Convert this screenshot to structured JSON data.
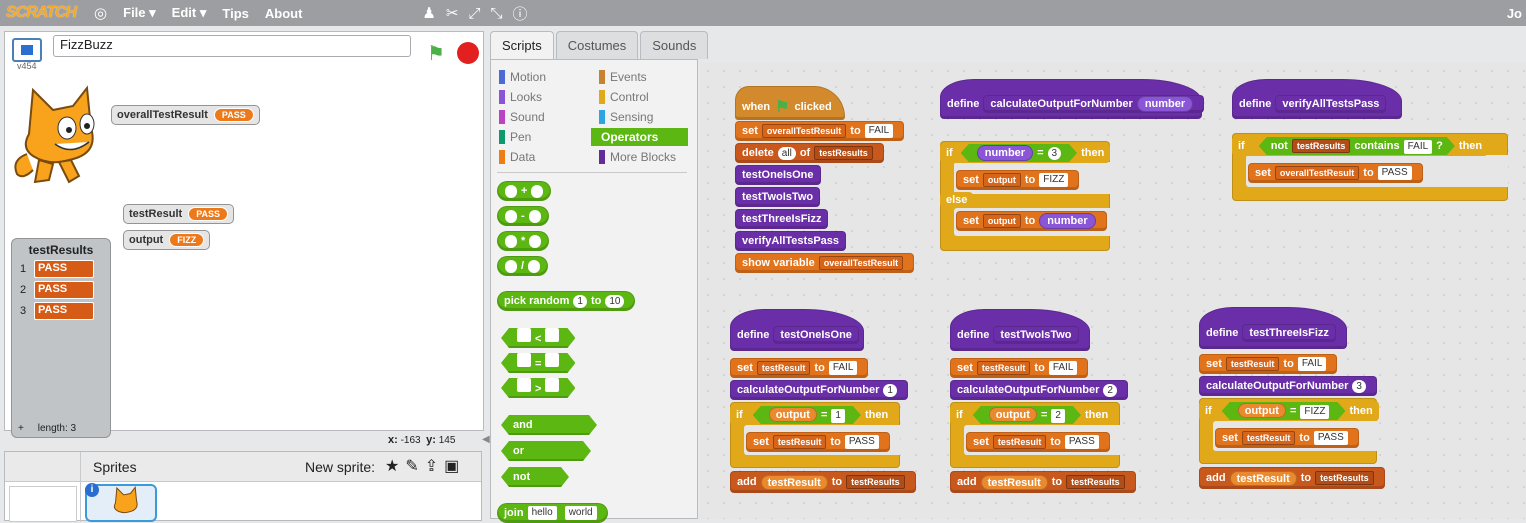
{
  "topbar": {
    "logo": "SCRATCH",
    "menus": [
      "File ▾",
      "Edit ▾",
      "Tips",
      "About"
    ],
    "user": "Jo",
    "icons": [
      "globe-icon",
      "duplicate-icon",
      "cut-icon",
      "grow-icon",
      "shrink-icon",
      "help-icon"
    ]
  },
  "stage": {
    "title": "FizzBuzz",
    "version": "v454",
    "monitors": {
      "overall": {
        "label": "overallTestResult",
        "value": "PASS"
      },
      "testResult": {
        "label": "testResult",
        "value": "PASS"
      },
      "output": {
        "label": "output",
        "value": "FIZZ"
      }
    },
    "list": {
      "title": "testResults",
      "items": [
        {
          "idx": "1",
          "val": "PASS"
        },
        {
          "idx": "2",
          "val": "PASS"
        },
        {
          "idx": "3",
          "val": "PASS"
        }
      ],
      "length": "length: 3",
      "add": "+"
    },
    "coords": {
      "x_label": "x:",
      "x": "-163",
      "y_label": "y:",
      "y": "145"
    }
  },
  "sprites": {
    "label": "Sprites",
    "new_sprite": "New sprite:",
    "info": "i"
  },
  "tabs": [
    "Scripts",
    "Costumes",
    "Sounds"
  ],
  "categories": [
    {
      "label": "Motion",
      "color": "#4a6cd4"
    },
    {
      "label": "Events",
      "color": "#c88330"
    },
    {
      "label": "Looks",
      "color": "#8a55d7"
    },
    {
      "label": "Control",
      "color": "#e1a91a"
    },
    {
      "label": "Sound",
      "color": "#bb42c3"
    },
    {
      "label": "Sensing",
      "color": "#2ca5e2"
    },
    {
      "label": "Pen",
      "color": "#0e9a6c"
    },
    {
      "label": "Operators",
      "color": "#5cb712"
    },
    {
      "label": "Data",
      "color": "#ee7d16"
    },
    {
      "label": "More Blocks",
      "color": "#632d99"
    }
  ],
  "palette": {
    "ops": [
      "+",
      "-",
      "*",
      "/"
    ],
    "pick": "pick random",
    "from": "1",
    "to_label": "to",
    "to": "10",
    "cmp": [
      "<",
      "=",
      ">"
    ],
    "and": "and",
    "or": "or",
    "not": "not",
    "join": "join",
    "hello": "hello",
    "world": "world"
  },
  "scripts": {
    "when": "when",
    "clicked": "clicked",
    "set": "set",
    "to": "to",
    "delete": "delete",
    "all": "all",
    "of": "of",
    "show_variable": "show variable",
    "fail": "FAIL",
    "pass": "PASS",
    "fizz": "FIZZ",
    "if": "if",
    "then": "then",
    "else": "else",
    "define": "define",
    "add": "add",
    "not": "not",
    "contains": "contains",
    "v_overall": "overallTestResult",
    "v_testResult": "testResult",
    "v_output": "output",
    "l_testResults": "testResults",
    "calls": [
      "testOneIsOne",
      "testTwoIsTwo",
      "testThreeIsFizz",
      "verifyAllTestsPass"
    ],
    "calc": "calculateOutputForNumber",
    "param": "number",
    "output_rep": "output",
    "n1": "1",
    "n2": "2",
    "n3": "3"
  }
}
